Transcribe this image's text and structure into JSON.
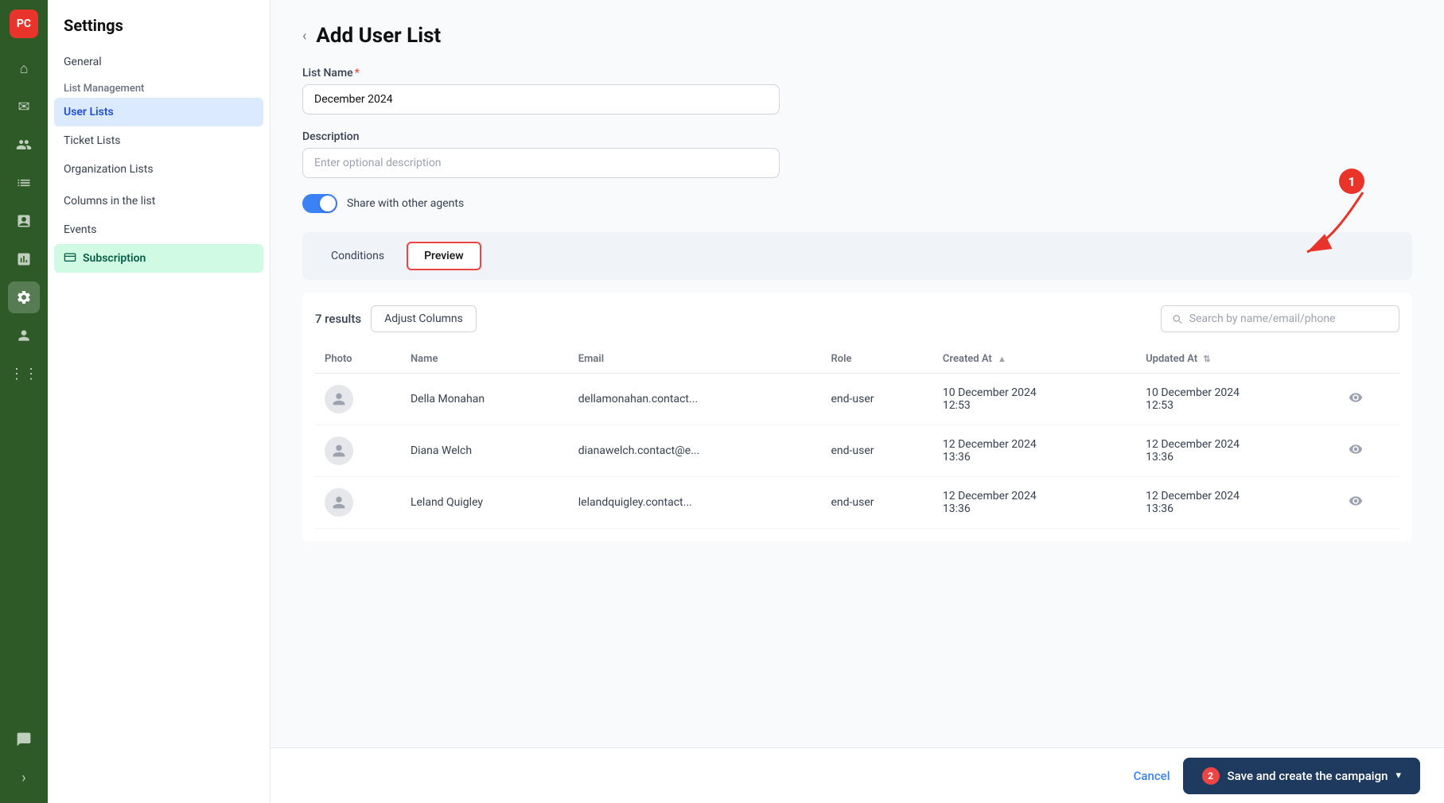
{
  "app": {
    "logo": "PC",
    "logo_bg": "#e8342a"
  },
  "icon_bar": {
    "items": [
      {
        "name": "home-icon",
        "icon": "⌂",
        "active": false
      },
      {
        "name": "mail-icon",
        "icon": "✉",
        "active": false
      },
      {
        "name": "contacts-icon",
        "icon": "👥",
        "active": false
      },
      {
        "name": "list-icon",
        "icon": "☰",
        "active": false
      },
      {
        "name": "chart-icon",
        "icon": "📊",
        "active": false
      },
      {
        "name": "dashboard-icon",
        "icon": "⊞",
        "active": false
      },
      {
        "name": "settings-icon",
        "icon": "⚙",
        "active": true
      },
      {
        "name": "users-icon",
        "icon": "👤",
        "active": false
      },
      {
        "name": "grid-icon",
        "icon": "⋮⋮",
        "active": false
      }
    ],
    "bottom_items": [
      {
        "name": "chat-icon",
        "icon": "💬"
      },
      {
        "name": "collapse-icon",
        "icon": "›"
      }
    ]
  },
  "sidebar": {
    "title": "Settings",
    "items": [
      {
        "label": "General",
        "active": false,
        "sub": false
      },
      {
        "label": "List Management",
        "active": false,
        "sub": false,
        "section": true
      },
      {
        "label": "User Lists",
        "active": true,
        "sub": true
      },
      {
        "label": "Ticket Lists",
        "active": false,
        "sub": true
      },
      {
        "label": "Organization Lists",
        "active": false,
        "sub": true
      },
      {
        "label": "Columns in the list",
        "active": false,
        "sub": false
      },
      {
        "label": "Events",
        "active": false,
        "sub": false
      },
      {
        "label": "Subscription",
        "active": false,
        "sub": false,
        "highlighted": true
      }
    ]
  },
  "page": {
    "back_label": "‹",
    "title": "Add User List"
  },
  "form": {
    "list_name_label": "List Name",
    "list_name_required": "*",
    "list_name_value": "December 2024",
    "description_label": "Description",
    "description_placeholder": "Enter optional description",
    "toggle_label": "Share with other agents",
    "toggle_on": true
  },
  "tabs": {
    "conditions_label": "Conditions",
    "preview_label": "Preview",
    "active_tab": "Preview"
  },
  "results": {
    "count_text": "7 results",
    "adjust_columns_label": "Adjust Columns",
    "search_placeholder": "Search by name/email/phone",
    "columns": [
      {
        "key": "photo",
        "label": "Photo"
      },
      {
        "key": "name",
        "label": "Name"
      },
      {
        "key": "email",
        "label": "Email"
      },
      {
        "key": "role",
        "label": "Role"
      },
      {
        "key": "created_at",
        "label": "Created At"
      },
      {
        "key": "updated_at",
        "label": "Updated At"
      }
    ],
    "rows": [
      {
        "name": "Della Monahan",
        "email": "dellamonahan.contact...",
        "role": "end-user",
        "created_at": "10 December 2024\n12:53",
        "updated_at": "10 December 2024\n12:53"
      },
      {
        "name": "Diana Welch",
        "email": "dianawelch.contact@e...",
        "role": "end-user",
        "created_at": "12 December 2024\n13:36",
        "updated_at": "12 December 2024\n13:36"
      },
      {
        "name": "Leland Quigley",
        "email": "lelandquigley.contact...",
        "role": "end-user",
        "created_at": "12 December 2024\n13:36",
        "updated_at": "12 December 2024\n13:36"
      }
    ]
  },
  "footer": {
    "cancel_label": "Cancel",
    "save_label": "Save and create the campaign",
    "save_badge": "2",
    "annotation_badge_1": "1"
  }
}
